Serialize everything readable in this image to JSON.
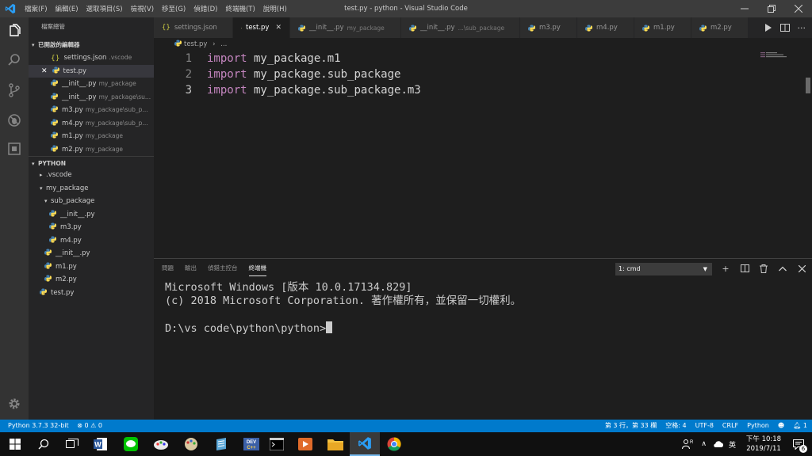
{
  "menu": [
    "檔案(F)",
    "編輯(E)",
    "選取項目(S)",
    "檢視(V)",
    "移至(G)",
    "偵錯(D)",
    "終端機(T)",
    "說明(H)"
  ],
  "window_title": "test.py - python - Visual Studio Code",
  "sidebar": {
    "title": "檔案總管",
    "open_editors_header": "已開啟的編輯器",
    "open_editors": [
      {
        "name": "settings.json",
        "desc": ".vscode",
        "icon": "json-icon"
      },
      {
        "name": "test.py",
        "desc": "",
        "icon": "python-icon"
      },
      {
        "name": "__init__.py",
        "desc": "my_package",
        "icon": "python-icon"
      },
      {
        "name": "__init__.py",
        "desc": "my_package\\su...",
        "icon": "python-icon"
      },
      {
        "name": "m3.py",
        "desc": "my_package\\sub_p...",
        "icon": "python-icon"
      },
      {
        "name": "m4.py",
        "desc": "my_package\\sub_p...",
        "icon": "python-icon"
      },
      {
        "name": "m1.py",
        "desc": "my_package",
        "icon": "python-icon"
      },
      {
        "name": "m2.py",
        "desc": "my_package",
        "icon": "python-icon"
      }
    ],
    "folder_header": "PYTHON",
    "tree": [
      {
        "name": ".vscode"
      },
      {
        "name": "my_package"
      },
      {
        "name": "sub_package"
      },
      {
        "name": "__init__.py"
      },
      {
        "name": "m3.py"
      },
      {
        "name": "m4.py"
      },
      {
        "name": "__init__.py"
      },
      {
        "name": "m1.py"
      },
      {
        "name": "m2.py"
      },
      {
        "name": "test.py"
      }
    ]
  },
  "tabs": [
    {
      "name": "settings.json",
      "desc": ""
    },
    {
      "name": "test.py",
      "desc": ""
    },
    {
      "name": "__init__.py",
      "desc": "my_package"
    },
    {
      "name": "__init__.py",
      "desc": "...\\sub_package"
    },
    {
      "name": "m3.py",
      "desc": ""
    },
    {
      "name": "m4.py",
      "desc": ""
    },
    {
      "name": "m1.py",
      "desc": ""
    },
    {
      "name": "m2.py",
      "desc": ""
    }
  ],
  "breadcrumb": {
    "file": "test.py",
    "sep": "›",
    "more": "..."
  },
  "editor": {
    "lines": [
      {
        "num": "1",
        "kw": "import",
        "rest": " my_package.m1"
      },
      {
        "num": "2",
        "kw": "import",
        "rest": " my_package.sub_package"
      },
      {
        "num": "3",
        "kw": "import",
        "rest": " my_package.sub_package.m3"
      }
    ]
  },
  "panel": {
    "tabs": [
      "問題",
      "輸出",
      "偵錯主控台",
      "終端機"
    ],
    "terminal_select": "1: cmd",
    "terminal_lines": [
      "Microsoft Windows [版本 10.0.17134.829]",
      "(c) 2018 Microsoft Corporation. 著作權所有，並保留一切權利。",
      "",
      "D:\\vs code\\python\\python>"
    ]
  },
  "status": {
    "interpreter": "Python 3.7.3 32-bit",
    "errors": "0",
    "warnings": "0",
    "position": "第 3 行，第 33 欄",
    "spaces": "空格: 4",
    "encoding": "UTF-8",
    "eol": "CRLF",
    "language": "Python",
    "notifications": "1"
  },
  "taskbar": {
    "ime": "英",
    "time": "下午 10:18",
    "date": "2019/7/11",
    "action_count": "6"
  },
  "colors": {
    "accent": "#007acc",
    "keyword": "#c586c0",
    "python": "#4584b6"
  }
}
